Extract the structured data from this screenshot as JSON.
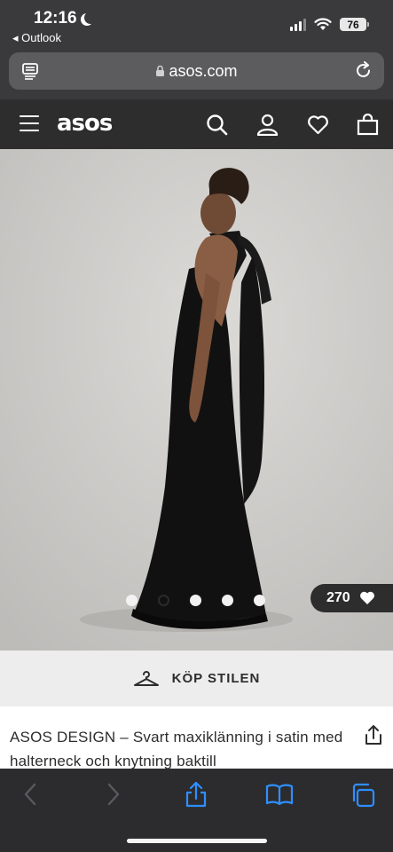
{
  "status_bar": {
    "time": "12:16",
    "back_app": "◂ Outlook",
    "battery": "76"
  },
  "browser": {
    "url": "asos.com"
  },
  "site_header": {
    "logo": "asos"
  },
  "product": {
    "saves_count": "270",
    "gallery_total": 5,
    "gallery_active_index": 1,
    "shop_the_look_label": "KÖP STILEN",
    "title": "ASOS DESIGN – Svart maxiklänning i satin med halterneck och knytning baktill"
  },
  "colors": {
    "header_bg": "#2d2d2d",
    "browser_chrome": "#3a3a3c",
    "toolbar_accent": "#2f8fff",
    "dress": "#111111"
  }
}
